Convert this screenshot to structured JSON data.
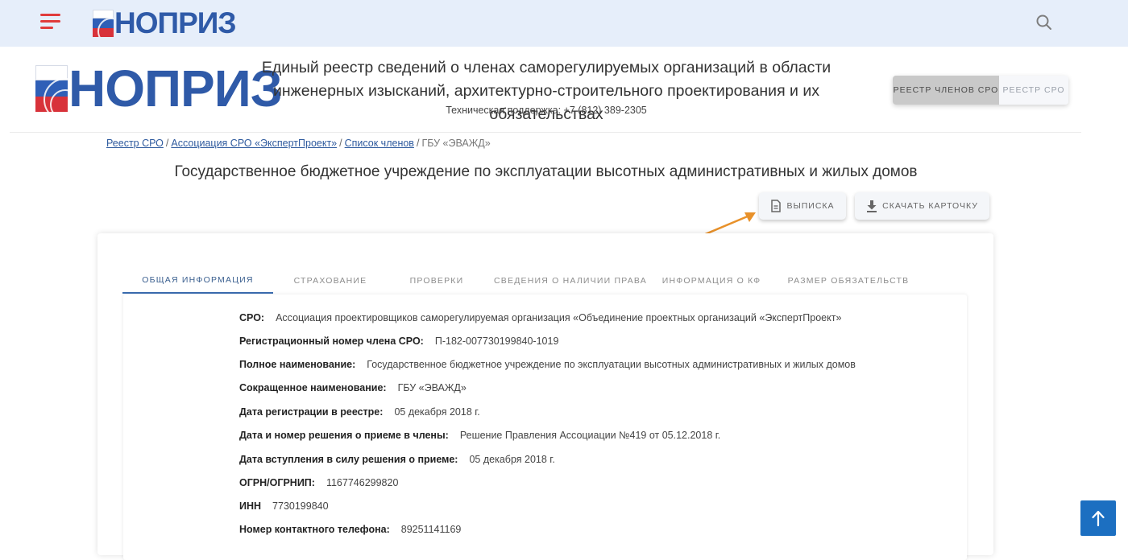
{
  "logo": {
    "text": "НОПРИЗ"
  },
  "header": {
    "title_line1": "Единый реестр сведений о членах саморегулируемых организаций в области",
    "title_line2": "инженерных изысканий, архитектурно-строительного проектирования и их обязательствах",
    "support": "Техническая поддержка: +7 (812) 389-2305"
  },
  "toggle": {
    "members": "РЕЕСТР ЧЛЕНОВ СРО",
    "sro": "РЕЕСТР СРО"
  },
  "breadcrumb": {
    "items": [
      "Реестр СРО",
      "Ассоциация СРО «ЭкспертПроект»",
      "Список членов"
    ],
    "current": "ГБУ «ЭВАЖД»",
    "separator": "/"
  },
  "page_title": "Государственное бюджетное учреждение по эксплуатации высотных административных и жилых домов",
  "actions": {
    "extract": "ВЫПИСКА",
    "download": "СКАЧАТЬ КАРТОЧКУ"
  },
  "tabs": [
    "ОБЩАЯ ИНФОРМАЦИЯ",
    "СТРАХОВАНИЕ",
    "ПРОВЕРКИ",
    "СВЕДЕНИЯ О НАЛИЧИИ ПРАВА",
    "ИНФОРМАЦИЯ О КФ",
    "РАЗМЕР ОБЯЗАТЕЛЬСТВ"
  ],
  "info": [
    {
      "label": "СРО:",
      "value": "Ассоциация проектировщиков саморегулируемая организация «Объединение проектных организаций «ЭкспертПроект»"
    },
    {
      "label": "Регистрационный номер члена СРО:",
      "value": "П-182-007730199840-1019"
    },
    {
      "label": "Полное наименование:",
      "value": "Государственное бюджетное учреждение по эксплуатации высотных административных и жилых домов"
    },
    {
      "label": "Сокращенное наименование:",
      "value": "ГБУ «ЭВАЖД»"
    },
    {
      "label": "Дата регистрации в реестре:",
      "value": "05 декабря 2018 г."
    },
    {
      "label": "Дата и номер решения о приеме в члены:",
      "value": "Решение Правления Ассоциации №419 от 05.12.2018 г."
    },
    {
      "label": "Дата вступления в силу решения о приеме:",
      "value": "05 декабря 2018 г."
    },
    {
      "label": "ОГРН/ОГРНИП:",
      "value": "1167746299820"
    },
    {
      "label": "ИНН",
      "value": "7730199840"
    },
    {
      "label": "Номер контактного телефона:",
      "value": "89251141169"
    }
  ],
  "colors": {
    "accent": "#1c6fc1",
    "arrow": "#e8912a",
    "hamburger": "#e03b3b",
    "logo_blue": "#2f5aa8"
  }
}
